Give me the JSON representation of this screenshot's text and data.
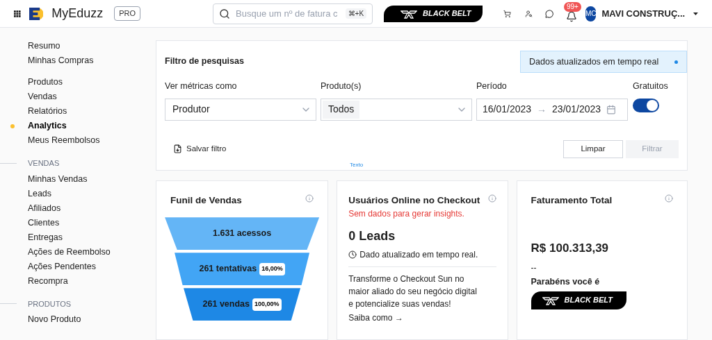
{
  "header": {
    "brand": "MyEduzz",
    "plan": "PRO",
    "search": {
      "placeholder": "Busque um nº de fatura c",
      "shortcut": "⌘+K"
    },
    "belt": "BLACK BELT",
    "notifications": "99+",
    "avatar": "MC",
    "account": "MAVI CONSTRUÇ..."
  },
  "sidebar": {
    "groups": [
      {
        "items": [
          {
            "label": "Resumo",
            "selected": false
          },
          {
            "label": "Minhas Compras",
            "selected": false
          }
        ]
      },
      {
        "items": [
          {
            "label": "Produtos",
            "selected": false
          },
          {
            "label": "Vendas",
            "selected": false
          },
          {
            "label": "Relatórios",
            "selected": false
          },
          {
            "label": "Analytics",
            "selected": true
          },
          {
            "label": "Meus Reembolsos",
            "selected": false
          }
        ]
      },
      {
        "heading": "VENDAS",
        "items": [
          {
            "label": "Minhas Vendas",
            "selected": false
          },
          {
            "label": "Leads",
            "selected": false
          },
          {
            "label": "Afiliados",
            "selected": false
          },
          {
            "label": "Clientes",
            "selected": false
          },
          {
            "label": "Entregas",
            "selected": false
          },
          {
            "label": "Ações de Reembolso",
            "selected": false
          },
          {
            "label": "Ações Pendentes",
            "selected": false
          },
          {
            "label": "Recompra",
            "selected": false
          }
        ]
      },
      {
        "heading": "PRODUTOS",
        "items": [
          {
            "label": "Novo Produto",
            "selected": false
          }
        ]
      }
    ]
  },
  "filter": {
    "title": "Filtro de pesquisas",
    "notice": "Dados atualizados em tempo real",
    "metrics": {
      "label": "Ver métricas como",
      "value": "Produtor"
    },
    "product": {
      "label": "Produto(s)",
      "value": "Todos"
    },
    "period": {
      "label": "Período",
      "from": "16/01/2023",
      "separator": "→",
      "to": "23/01/2023"
    },
    "free": {
      "label": "Gratuitos",
      "on": true
    },
    "save": "Salvar filtro",
    "tiny": "Texto",
    "clear": "Limpar",
    "apply": {
      "label": "Filtrar",
      "disabled": true
    }
  },
  "funnel": {
    "title": "Funil de Vendas",
    "stages": [
      {
        "label": "1.631 acessos",
        "color": "#64b5f6"
      },
      {
        "label": "261 tentativas",
        "badge": "16,00%",
        "color": "#42a5f5"
      },
      {
        "label": "261 vendas",
        "badge": "100,00%",
        "color": "#1e88e5"
      }
    ]
  },
  "checkout": {
    "title": "Usuários Online no Checkout",
    "warning": "Sem dados para gerar insights.",
    "leads": "0 Leads",
    "updated": "Dado atualizado em tempo real.",
    "promo": "Transforme o Checkout Sun no maior aliado do seu negócio digital e potencialize suas vendas!",
    "link": "Saiba como →"
  },
  "revenue": {
    "title": "Faturamento Total",
    "amount": "R$ 100.313,39",
    "delta": "--",
    "congrats": "Parabéns você é",
    "belt": "BLACK BELT"
  }
}
